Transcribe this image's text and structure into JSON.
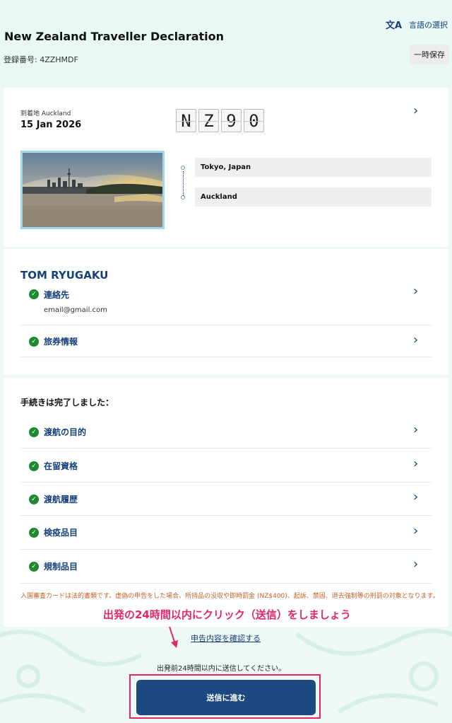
{
  "header": {
    "title": "New Zealand Traveller Declaration",
    "registration": "登録番号: 4ZZHMDF",
    "language_label": "言語の選択",
    "save_label": "一時保存"
  },
  "trip": {
    "arrival_label": "到着地 Auckland",
    "arrival_date": "15 Jan 2026",
    "flight_chars": [
      "N",
      "Z",
      "9",
      "0"
    ],
    "origin": "Tokyo, Japan",
    "destination": "Auckland"
  },
  "traveller": {
    "name": "TOM RYUGAKU",
    "contact_label": "連絡先",
    "contact_email": "email@gmail.com",
    "passport_label": "旅券情報"
  },
  "completion": {
    "title": "手続きは完了しました：",
    "items": [
      "渡航の目的",
      "在留資格",
      "渡航履歴",
      "検疫品目",
      "規制品目"
    ],
    "legal_notice": "入国審査カードは法的書類です。虚偽の申告をした場合、所持品の没収や即時罰金 (NZ$400)、起訴、禁固、退去強制等の刑罰の対象となります。"
  },
  "footer": {
    "annotation": "出発の24時間以内にクリック（送信）をしましょう",
    "confirm_link": "申告内容を確認する",
    "send_note": "出発前24時間以内に送信してください。",
    "submit_label": "送信に進む"
  },
  "colors": {
    "brand_navy": "#16407a",
    "button_navy": "#1c4a80",
    "check_green": "#1e8a30",
    "annotation_pink": "#e3266a",
    "legal_orange": "#c0612a"
  }
}
